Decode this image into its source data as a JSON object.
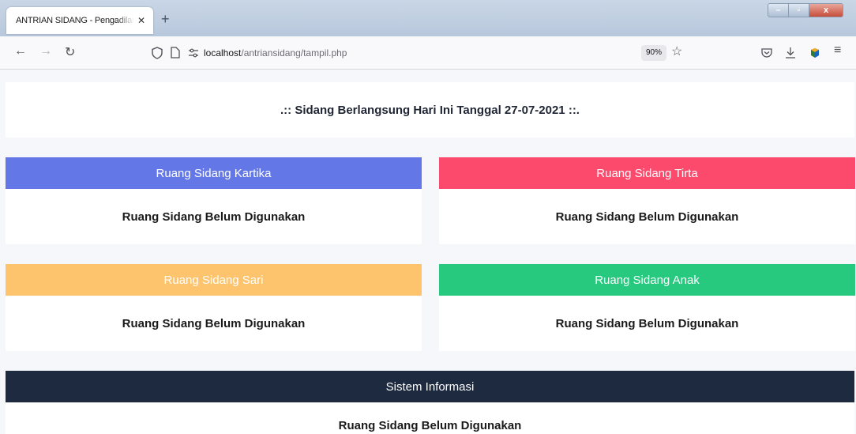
{
  "browser": {
    "tab_title": "ANTRIAN SIDANG - Pengadilan",
    "tab_close": "✕",
    "new_tab": "+",
    "url_host": "localhost",
    "url_path": "/antriansidang/tampil.php",
    "zoom": "90%",
    "icons": [
      "back-arrow-icon",
      "forward-arrow-icon",
      "reload-icon",
      "shield-icon",
      "page-icon",
      "permissions-icon",
      "bookmark-star-icon",
      "pocket-icon",
      "download-icon",
      "extension-icon",
      "menu-icon"
    ]
  },
  "page": {
    "header": ".:: Sidang Berlangsung Hari Ini Tanggal 27-07-2021 ::.",
    "rooms": [
      {
        "name": "Ruang Sidang Kartika",
        "status": "Ruang Sidang Belum Digunakan",
        "color": "#6378e6"
      },
      {
        "name": "Ruang Sidang Tirta",
        "status": "Ruang Sidang Belum Digunakan",
        "color": "#fb4a6c"
      },
      {
        "name": "Ruang Sidang Sari",
        "status": "Ruang Sidang Belum Digunakan",
        "color": "#fdc46d"
      },
      {
        "name": "Ruang Sidang Anak",
        "status": "Ruang Sidang Belum Digunakan",
        "color": "#27c97f"
      }
    ],
    "info": {
      "title": "Sistem Informasi",
      "status": "Ruang Sidang Belum Digunakan",
      "color": "#1d2a40"
    }
  }
}
